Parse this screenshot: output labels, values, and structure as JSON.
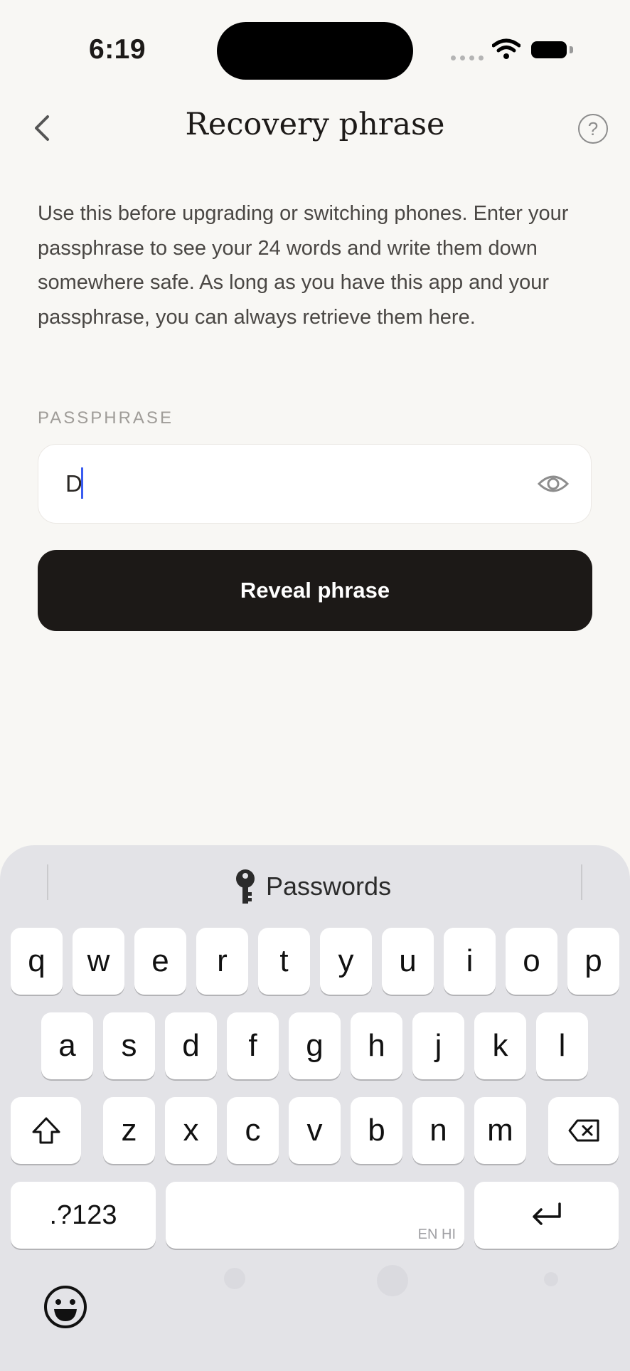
{
  "status_bar": {
    "time": "6:19"
  },
  "nav": {
    "title": "Recovery phrase",
    "back_icon": "chevron-left-icon",
    "help_icon": "question-circle-icon",
    "help_glyph": "?"
  },
  "description": "Use this before upgrading or switching phones. Enter your passphrase to see your 24 words and write them down somewhere safe. As long as you have this app and your passphrase, you can always retrieve them here.",
  "passphrase": {
    "label": "PASSPHRASE",
    "value": "D",
    "toggle_icon": "eye-icon"
  },
  "reveal_button": {
    "label": "Reveal phrase"
  },
  "keyboard": {
    "suggestion": "Passwords",
    "row1": [
      "q",
      "w",
      "e",
      "r",
      "t",
      "y",
      "u",
      "i",
      "o",
      "p"
    ],
    "row2": [
      "a",
      "s",
      "d",
      "f",
      "g",
      "h",
      "j",
      "k",
      "l"
    ],
    "row3": [
      "z",
      "x",
      "c",
      "v",
      "b",
      "n",
      "m"
    ],
    "numbers_key": ".?123",
    "space_languages": "EN HI",
    "accent": "#3a5cf0"
  }
}
